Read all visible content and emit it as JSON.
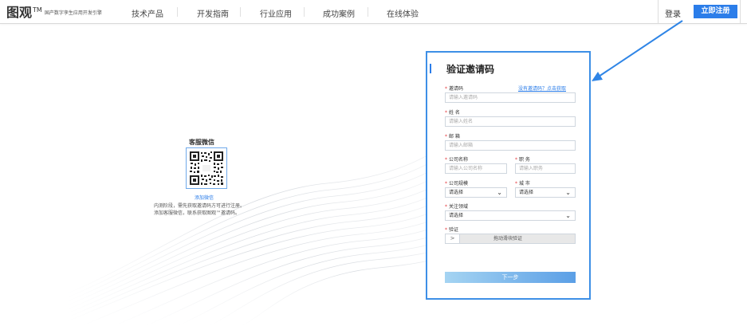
{
  "header": {
    "logo_main": "图观",
    "logo_tm": "TM",
    "logo_sub": "国产数字孪生应用开发引擎",
    "nav": [
      "技术产品",
      "开发指南",
      "行业应用",
      "成功案例",
      "在线体验"
    ],
    "login": "登录",
    "register": "立即注册"
  },
  "contact": {
    "title": "客服微信",
    "caption": "添加微信",
    "desc_line1": "内测阶段，需先获取邀请码方可进行注册。",
    "desc_line2": "添加客服微信，联系获取图观™邀请码。"
  },
  "form": {
    "title": "验证邀请码",
    "invite_label": "邀请码",
    "invite_placeholder": "请输入邀请码",
    "invite_link": "没有邀请码？点击获取",
    "name_label": "姓 名",
    "name_placeholder": "请输入姓名",
    "email_label": "邮 箱",
    "email_placeholder": "请输入邮箱",
    "company_label": "公司名称",
    "company_placeholder": "请输入公司名称",
    "position_label": "职 务",
    "position_placeholder": "请输入职务",
    "scale_label": "公司规模",
    "scale_value": "请选择",
    "city_label": "城 市",
    "city_value": "请选择",
    "field_label": "关注领域",
    "field_value": "请选择",
    "verify_label": "验证",
    "slider_handle": ">",
    "slider_text": "拖动滑块验证",
    "next_button": "下一步"
  },
  "colors": {
    "accent": "#2b7de9",
    "card_border": "#3d8fe6",
    "required": "#e4393c"
  }
}
